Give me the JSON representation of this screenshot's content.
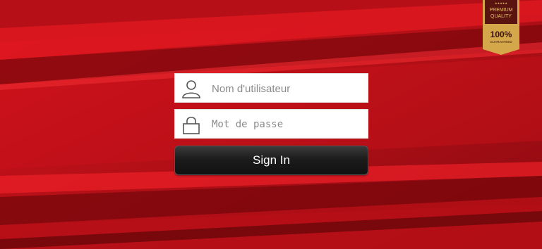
{
  "login": {
    "username_placeholder": "Nom d'utilisateur",
    "password_placeholder": "Mot de passe",
    "signin_label": "Sign In"
  },
  "badge": {
    "line1": "PREMIUM",
    "line2": "QUALITY",
    "percent": "100%",
    "guarantee": "GUARANTEED",
    "stars": "★★★★★"
  },
  "icons": {
    "username": "user-icon",
    "password": "lock-icon"
  },
  "colors": {
    "background_red": "#9c0d13",
    "bright_red": "#e0161f",
    "gold": "#d4a84a",
    "badge_dark": "#5a1410"
  }
}
